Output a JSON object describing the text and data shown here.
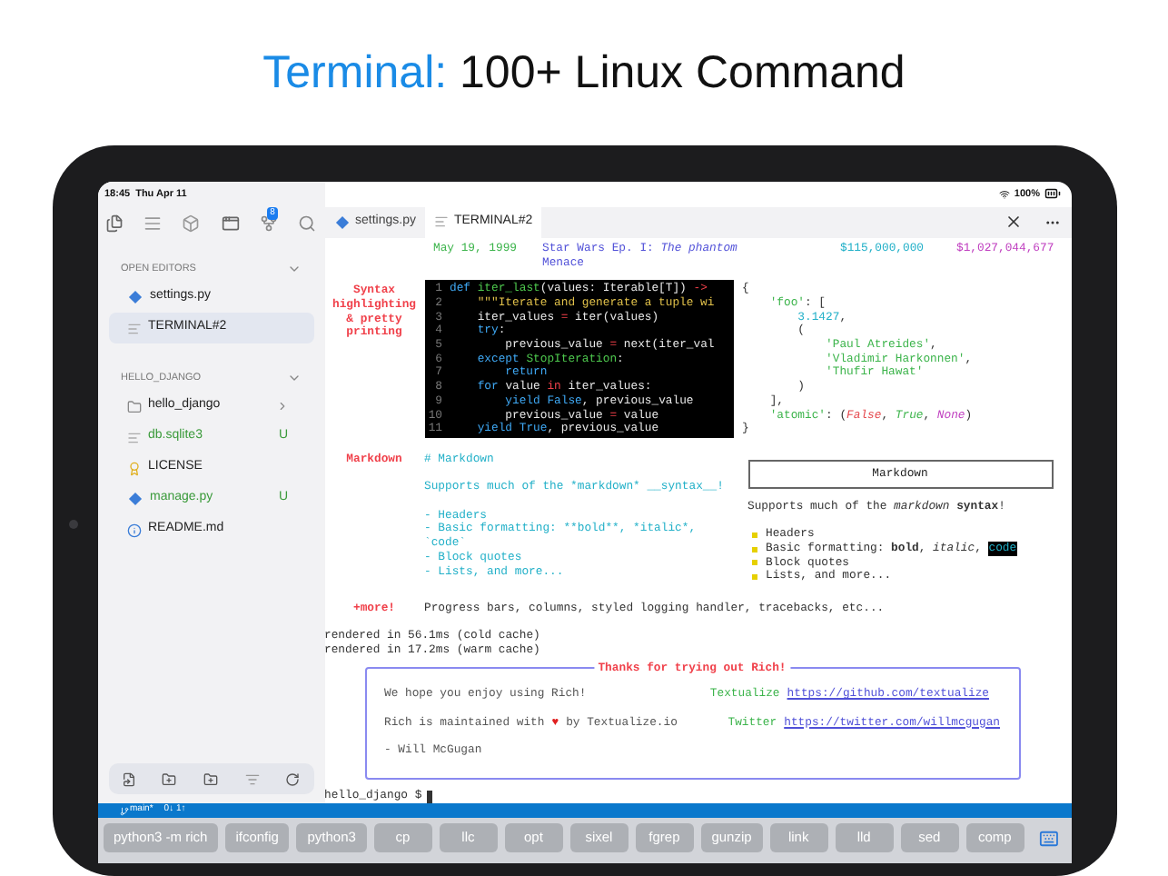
{
  "headline": {
    "accent": "Terminal:",
    "rest": "100+ Linux Command"
  },
  "status": {
    "time": "18:45",
    "date": "Thu Apr 11",
    "battery": "100%"
  },
  "toolbar": {
    "badge": "8"
  },
  "sidebar": {
    "sections": [
      {
        "title": "OPEN EDITORS",
        "expanded": true,
        "items": [
          {
            "kind": "python",
            "label": "settings.py",
            "selected": false,
            "untracked": false
          },
          {
            "kind": "text",
            "label": "TERMINAL#2",
            "selected": true,
            "untracked": false
          }
        ]
      },
      {
        "title": "HELLO_DJANGO",
        "expanded": true,
        "items": [
          {
            "kind": "folder",
            "label": "hello_django",
            "selected": false,
            "untracked": false
          },
          {
            "kind": "text",
            "label": "db.sqlite3",
            "selected": false,
            "untracked": true,
            "badge": "U"
          },
          {
            "kind": "license",
            "label": "LICENSE",
            "selected": false,
            "untracked": false
          },
          {
            "kind": "python",
            "label": "manage.py",
            "selected": false,
            "untracked": true,
            "badge": "U"
          },
          {
            "kind": "info",
            "label": "README.md",
            "selected": false,
            "untracked": false
          }
        ]
      }
    ]
  },
  "tabs": [
    {
      "kind": "python",
      "label": "settings.py",
      "selected": false
    },
    {
      "kind": "text",
      "label": "TERMINAL#2",
      "selected": true
    }
  ],
  "terminal": {
    "movie": {
      "date": "May 19, 1999",
      "title": "Star Wars Ep. I: *The phantom* Menace",
      "budget": "$115,000,000",
      "gross": "$1,027,044,677"
    },
    "syntax_label": "Syntax highlighting & pretty printing",
    "code": [
      {
        "num": "1",
        "tokens": [
          {
            "kind": "kw",
            "text": "def "
          },
          {
            "kind": "fn",
            "text": "iter_last"
          },
          {
            "kind": "plain",
            "text": "(values: Iterable[T]) "
          },
          {
            "kind": "op",
            "text": "->"
          }
        ]
      },
      {
        "num": "2",
        "tokens": [
          {
            "kind": "str",
            "text": "    \"\"\"Iterate and generate a tuple wi"
          }
        ]
      },
      {
        "num": "3",
        "tokens": [
          {
            "kind": "plain",
            "text": "    iter_values "
          },
          {
            "kind": "op",
            "text": "="
          },
          {
            "kind": "plain",
            "text": " iter(values)"
          }
        ]
      },
      {
        "num": "4",
        "tokens": [
          {
            "kind": "kw",
            "text": "    try"
          },
          {
            "kind": "plain",
            "text": ":"
          }
        ]
      },
      {
        "num": "5",
        "tokens": [
          {
            "kind": "plain",
            "text": "        previous_value "
          },
          {
            "kind": "op",
            "text": "="
          },
          {
            "kind": "plain",
            "text": " next(iter_val"
          }
        ]
      },
      {
        "num": "6",
        "tokens": [
          {
            "kind": "kw",
            "text": "    except "
          },
          {
            "kind": "fn",
            "text": "StopIteration"
          },
          {
            "kind": "plain",
            "text": ":"
          }
        ]
      },
      {
        "num": "7",
        "tokens": [
          {
            "kind": "kw",
            "text": "        return"
          }
        ]
      },
      {
        "num": "8",
        "tokens": [
          {
            "kind": "kw",
            "text": "    for"
          },
          {
            "kind": "plain",
            "text": " value "
          },
          {
            "kind": "op",
            "text": "in"
          },
          {
            "kind": "plain",
            "text": " iter_values:"
          }
        ]
      },
      {
        "num": "9",
        "tokens": [
          {
            "kind": "kw",
            "text": "        yield "
          },
          {
            "kind": "const",
            "text": "False"
          },
          {
            "kind": "plain",
            "text": ", previous_value"
          }
        ]
      },
      {
        "num": "10",
        "tokens": [
          {
            "kind": "plain",
            "text": "        previous_value "
          },
          {
            "kind": "op",
            "text": "="
          },
          {
            "kind": "plain",
            "text": " value"
          }
        ]
      },
      {
        "num": "11",
        "tokens": [
          {
            "kind": "kw",
            "text": "    yield "
          },
          {
            "kind": "const",
            "text": "True"
          },
          {
            "kind": "plain",
            "text": ", previous_value"
          }
        ]
      }
    ],
    "pretty": [
      [
        {
          "kind": "punct",
          "text": "{"
        }
      ],
      [
        {
          "kind": "str",
          "text": "    'foo'"
        },
        {
          "kind": "punct",
          "text": ": ["
        }
      ],
      [
        {
          "kind": "num",
          "text": "        3.1427"
        },
        {
          "kind": "punct",
          "text": ","
        }
      ],
      [
        {
          "kind": "punct",
          "text": "        ("
        }
      ],
      [
        {
          "kind": "str",
          "text": "            'Paul Atreides'"
        },
        {
          "kind": "punct",
          "text": ","
        }
      ],
      [
        {
          "kind": "str",
          "text": "            'Vladimir Harkonnen'"
        },
        {
          "kind": "punct",
          "text": ","
        }
      ],
      [
        {
          "kind": "str",
          "text": "            'Thufir Hawat'"
        }
      ],
      [
        {
          "kind": "punct",
          "text": "        )"
        }
      ],
      [
        {
          "kind": "punct",
          "text": "    ],"
        }
      ],
      [
        {
          "kind": "str",
          "text": "    'atomic'"
        },
        {
          "kind": "punct",
          "text": ": ("
        },
        {
          "kind": "false",
          "text": "False"
        },
        {
          "kind": "punct",
          "text": ", "
        },
        {
          "kind": "true",
          "text": "True"
        },
        {
          "kind": "punct",
          "text": ", "
        },
        {
          "kind": "none",
          "text": "None"
        },
        {
          "kind": "punct",
          "text": ")"
        }
      ],
      [
        {
          "kind": "punct",
          "text": "}"
        }
      ]
    ],
    "markdown_label": "Markdown",
    "markdown_source": [
      [
        "# Markdown"
      ],
      [
        "Supports much of the *markdown* __syntax__!"
      ],
      [
        "- Headers",
        "- Basic formatting: **bold**, *italic*,",
        "`code`",
        "- Block quotes",
        "- Lists, and more..."
      ]
    ],
    "markdown_heading": "Markdown",
    "markdown_intro": "Supports much of the *markdown* **syntax**!",
    "markdown_bullets": [
      {
        "text": "Headers"
      },
      {
        "text": "Basic formatting: **bold**, *italic*, ",
        "code": "code"
      },
      {
        "text": "Block quotes"
      },
      {
        "text": "Lists, and more..."
      }
    ],
    "more_label": "+more!",
    "more_text": "Progress bars, columns, styled logging handler, tracebacks, etc...",
    "timings": [
      "rendered in 56.1ms (cold cache)",
      "rendered in 17.2ms (warm cache)"
    ],
    "thanks": {
      "title": "Thanks for trying out Rich!",
      "line1": "We hope you enjoy using Rich!",
      "line2_start": "Rich is maintained with",
      "heart": "♥",
      "line2_end": "by Textualize.io",
      "signature": "- Will McGugan",
      "links": [
        {
          "label": "Textualize",
          "url": "https://github.com/textualize"
        },
        {
          "label": "Twitter",
          "url": "https://twitter.com/willmcgugan"
        }
      ]
    },
    "prompt": "hello_django $"
  },
  "status_bar": {
    "branch": "main*",
    "sync": "0↓ 1↑"
  },
  "keys": [
    "python3 -m rich",
    "ifconfig",
    "python3",
    "cp",
    "llc",
    "opt",
    "sixel",
    "fgrep",
    "gunzip",
    "link",
    "lld",
    "sed",
    "comp"
  ]
}
